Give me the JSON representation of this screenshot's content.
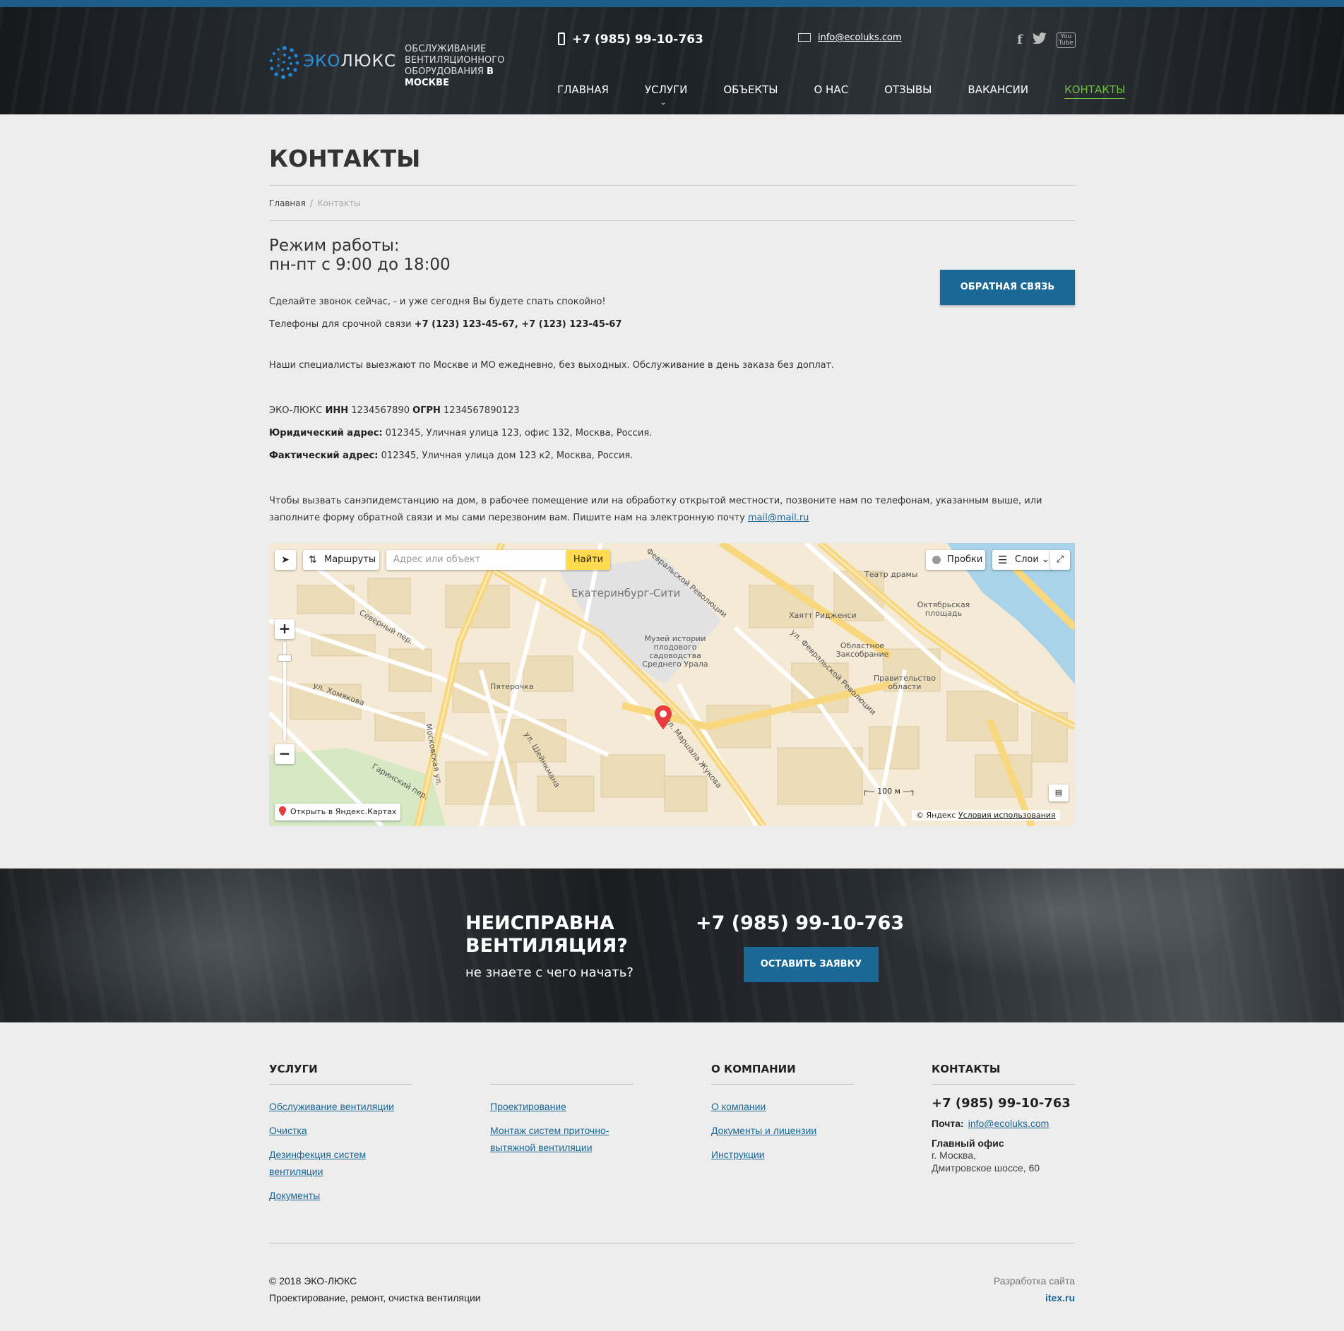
{
  "header": {
    "logo_eko": "ЭКО",
    "logo_lux": "ЛЮКС",
    "tagline_1": "ОБСЛУЖИВАНИЕ",
    "tagline_2": "ВЕНТИЛЯЦИОННОГО",
    "tagline_3": "ОБОРУДОВАНИЯ",
    "tagline_in": "В",
    "tagline_city": "МОСКВЕ",
    "phone": "+7 (985) 99-10-763",
    "email": "info@ecoluks.com",
    "social": [
      "facebook-icon",
      "twitter-icon",
      "youtube-icon"
    ],
    "youtube_1": "You",
    "youtube_2": "Tube",
    "nav": [
      "ГЛАВНАЯ",
      "УСЛУГИ",
      "ОБЪЕКТЫ",
      "О НАС",
      "ОТЗЫВЫ",
      "ВАКАНСИИ",
      "КОНТАКТЫ"
    ],
    "nav_active": "КОНТАКТЫ"
  },
  "page": {
    "title": "КОНТАКТЫ",
    "breadcrumb_home": "Главная",
    "breadcrumb_current": "Контакты",
    "hours_label": "Режим работы:",
    "hours_value": "пн-пт с 9:00 до 18:00",
    "feedback_button": "ОБРАТНАЯ СВЯЗЬ",
    "call_now": "Сделайте звонок сейчас, - и уже сегодня Вы будете спать спокойно!",
    "urgent_label": "Телефоны для срочной связи",
    "urgent_phones": "+7 (123) 123-45-67, +7 (123) 123-45-67",
    "service_text": "Наши специалисты выезжают по Москве и МО ежедневно, без выходных. Обслуживание в день заказа без доплат.",
    "company": "ЭКО-ЛЮКС",
    "inn_label": "ИНН",
    "inn": "1234567890",
    "ogrn_label": "ОГРН",
    "ogrn": "1234567890123",
    "legal_label": "Юридический адрес:",
    "legal_address": "012345, Уличная улица 123, офис 132, Москва, Россия.",
    "actual_label": "Фактический адрес:",
    "actual_address": "012345, Уличная улица дом 123 к2, Москва, Россия.",
    "call_info": "Чтобы вызвать санэпидемстанцию на дом, в рабочее помещение или на обработку открытой местности, позвоните нам по телефонам, указанным выше, или заполните форму обратной связи и мы сами перезвоним вам. Пишите нам на электронную почту",
    "contact_email": "mail@mail.ru"
  },
  "map": {
    "routes": "Маршруты",
    "search_placeholder": "Адрес или объект",
    "find": "Найти",
    "traffic": "Пробки",
    "layers": "Слои",
    "open_in_yandex": "Открыть в Яндекс.Картах",
    "scale": "100 м",
    "copyright": "© Яндекс",
    "terms": "Условия использования",
    "labels": {
      "city": "Екатеринбург-Сити",
      "street_marshal": "ул. Маршала Жукова",
      "street_moscow": "Московская ул.",
      "street_feb": "Февральской Революции",
      "street_feb2": "ул. Февральской Революции",
      "street_severny": "Северный пер.",
      "street_homyakova": "ул. Хомякова",
      "street_sheinkmana": "ул. Шейнкмана",
      "street_garinsky": "Гаринский пер.",
      "museum": "Музей истории плодового садоводства Среднего Урала",
      "hyatt": "Хаятт Ридженси",
      "oktyabrskaya": "Октябрьская площадь",
      "zakso": "Областное Заксобрание",
      "government": "Правительство области",
      "pyaterochka": "Пятерочка",
      "theatre": "Театр драмы"
    }
  },
  "cta": {
    "title_1": "НЕИСПРАВНА",
    "title_2": "ВЕНТИЛЯЦИЯ?",
    "subtitle": "не знаете с чего начать?",
    "phone": "+7 (985) 99-10-763",
    "button": "ОСТАВИТЬ ЗАЯВКУ"
  },
  "footer": {
    "services_title": "УСЛУГИ",
    "services_col1": [
      "Обслуживание вентиляции",
      "Очистка",
      "Дезинфекция систем вентиляции",
      "Документы"
    ],
    "services_col2": [
      "Проектирование",
      "Монтаж систем приточно-вытяжной вентиляции"
    ],
    "about_title": "О КОМПАНИИ",
    "about_links": [
      "О компании",
      "Документы и лицензии",
      "Инструкции"
    ],
    "contacts_title": "КОНТАКТЫ",
    "phone": "+7 (985) 99-10-763",
    "mail_label": "Почта:",
    "mail": "info@ecoluks.com",
    "office_label": "Главный офис",
    "office_line1": "г. Москва,",
    "office_line2": "Дмитровское шоссе, 60",
    "copyright": "© 2018 ЭКО-ЛЮКС",
    "slogan": "Проектирование, ремонт, очистка вентиляции",
    "dev_label": "Разработка сайта",
    "dev_link": "itex.ru"
  },
  "colors": {
    "accent": "#1a6896",
    "nav_active": "#6fbf3f",
    "top_bar": "#1d5d8a",
    "find_button": "#ffdb4d"
  }
}
